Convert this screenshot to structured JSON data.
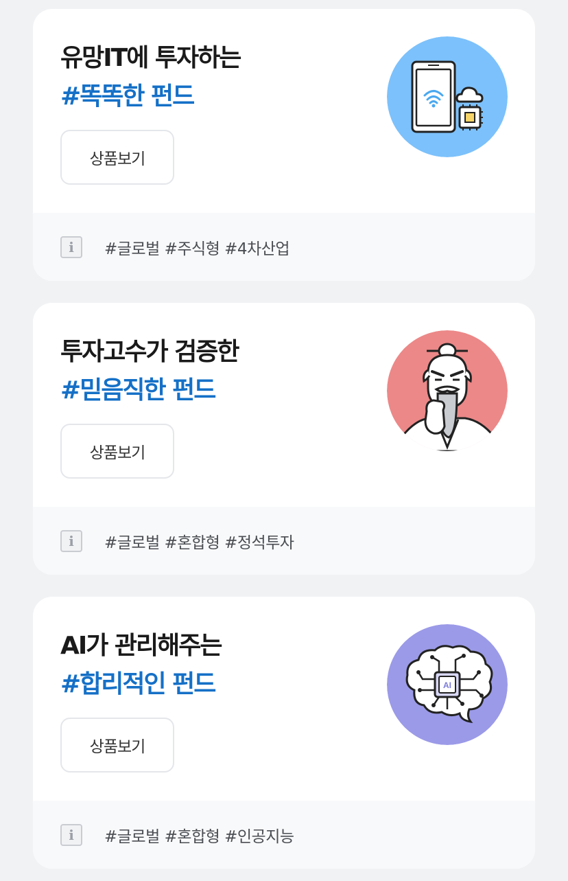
{
  "funds": [
    {
      "headline": "유망IT에 투자하는",
      "highlight": "#똑똑한 펀드",
      "button_label": "상품보기",
      "tags": "#글로벌 #주식형 #4차산업",
      "illustration": "smartphone-cloud-chip-icon",
      "illustration_bg": "#7cc1fb"
    },
    {
      "headline": "투자고수가 검증한",
      "highlight": "#믿음직한 펀드",
      "button_label": "상품보기",
      "tags": "#글로벌 #혼합형 #정석투자",
      "illustration": "wise-old-man-icon",
      "illustration_bg": "#ec8888"
    },
    {
      "headline": "AI가 관리해주는",
      "highlight": "#합리적인 펀드",
      "button_label": "상품보기",
      "tags": "#글로벌 #혼합형 #인공지능",
      "illustration": "ai-brain-icon",
      "illustration_bg": "#9b9ae8",
      "chip_label": "AI"
    }
  ],
  "info_icon_glyph": "i",
  "colors": {
    "page_bg": "#f1f2f4",
    "highlight": "#1570c7",
    "headline": "#1a1a1a"
  }
}
